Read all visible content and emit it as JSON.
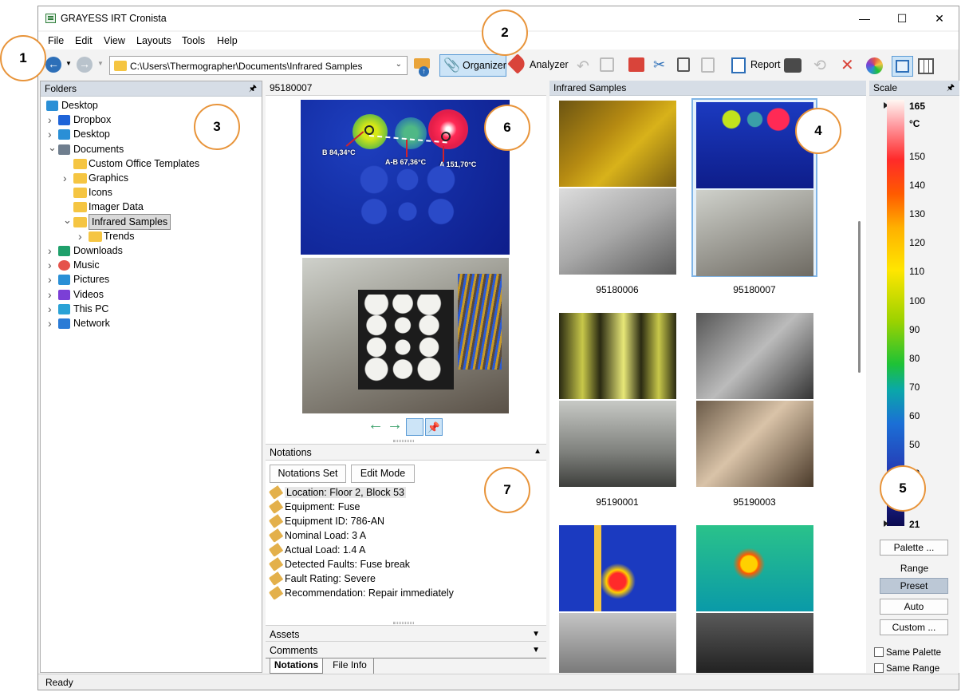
{
  "window": {
    "title": "GRAYESS IRT Cronista",
    "minimize": "—",
    "maximize": "☐",
    "close": "✕"
  },
  "menu": [
    "File",
    "Edit",
    "View",
    "Layouts",
    "Tools",
    "Help"
  ],
  "toolbar": {
    "path": "C:\\Users\\Thermographer\\Documents\\Infrared Samples",
    "organizer": "Organizer",
    "analyzer": "Analyzer",
    "report": "Report"
  },
  "folders": {
    "title": "Folders",
    "pin": "🖈",
    "items": [
      {
        "label": "Desktop",
        "level": 0,
        "chevron": "",
        "icon": "desktop-icon",
        "color": "#2a8fd6"
      },
      {
        "label": "Dropbox",
        "level": 1,
        "chevron": "›",
        "icon": "dropbox-icon",
        "color": "#1f64d8"
      },
      {
        "label": "Desktop",
        "level": 1,
        "chevron": "›",
        "icon": "desktop-icon",
        "color": "#2a8fd6"
      },
      {
        "label": "Documents",
        "level": 1,
        "chevron": "⌄",
        "icon": "documents-icon",
        "color": "#6f7e8e"
      },
      {
        "label": "Custom Office Templates",
        "level": 2,
        "chevron": "",
        "icon": "folder-icon",
        "color": "#f5c542"
      },
      {
        "label": "Graphics",
        "level": 2,
        "chevron": "›",
        "icon": "folder-icon",
        "color": "#f5c542"
      },
      {
        "label": "Icons",
        "level": 2,
        "chevron": "",
        "icon": "folder-icon",
        "color": "#f5c542"
      },
      {
        "label": "Imager Data",
        "level": 2,
        "chevron": "",
        "icon": "folder-icon",
        "color": "#f5c542"
      },
      {
        "label": "Infrared Samples",
        "level": 2,
        "chevron": "⌄",
        "icon": "folder-icon",
        "color": "#f5c542",
        "selected": true
      },
      {
        "label": "Trends",
        "level": 3,
        "chevron": "›",
        "icon": "folder-icon",
        "color": "#f5c542"
      },
      {
        "label": "Downloads",
        "level": 1,
        "chevron": "›",
        "icon": "downloads-icon",
        "color": "#1fa06b"
      },
      {
        "label": "Music",
        "level": 1,
        "chevron": "›",
        "icon": "music-icon",
        "color": "#e5534b"
      },
      {
        "label": "Pictures",
        "level": 1,
        "chevron": "›",
        "icon": "pictures-icon",
        "color": "#2a8fd6"
      },
      {
        "label": "Videos",
        "level": 1,
        "chevron": "›",
        "icon": "videos-icon",
        "color": "#7b3fd6"
      },
      {
        "label": "This PC",
        "level": 1,
        "chevron": "›",
        "icon": "pc-icon",
        "color": "#2aa2d6"
      },
      {
        "label": "Network",
        "level": 1,
        "chevron": "›",
        "icon": "network-icon",
        "color": "#2a7bd6"
      }
    ]
  },
  "preview": {
    "title": "95180007",
    "labels": {
      "b": "B 84,34°C",
      "ab": "A-B 67,36°C",
      "a": "A 151,70°C"
    }
  },
  "notations": {
    "title": "Notations",
    "set_btn": "Notations Set",
    "edit_btn": "Edit Mode",
    "items": [
      "Location: Floor 2, Block 53",
      "Equipment: Fuse",
      "Equipment ID: 786-AN",
      "Nominal Load: 3 A",
      "Actual Load: 1.4 A",
      "Detected Faults: Fuse break",
      "Fault Rating: Severe",
      "Recommendation: Repair immediately"
    ]
  },
  "sections": {
    "assets": "Assets",
    "comments": "Comments"
  },
  "tabs": [
    "Notations",
    "File Info"
  ],
  "gallery": {
    "title": "Infrared Samples",
    "items": [
      "95180006",
      "95180007",
      "95190001",
      "95190003"
    ]
  },
  "scale": {
    "title": "Scale",
    "max": "165",
    "unit": "°C",
    "ticks": [
      "150",
      "140",
      "130",
      "120",
      "110",
      "100",
      "90",
      "80",
      "70",
      "60",
      "50",
      "40"
    ],
    "min": "21",
    "palette_btn": "Palette ...",
    "range_label": "Range",
    "preset_btn": "Preset",
    "auto_btn": "Auto",
    "custom_btn": "Custom ...",
    "same_palette": "Same Palette",
    "same_range": "Same Range"
  },
  "status": "Ready",
  "callouts": [
    "1",
    "2",
    "3",
    "4",
    "5",
    "6",
    "7"
  ]
}
